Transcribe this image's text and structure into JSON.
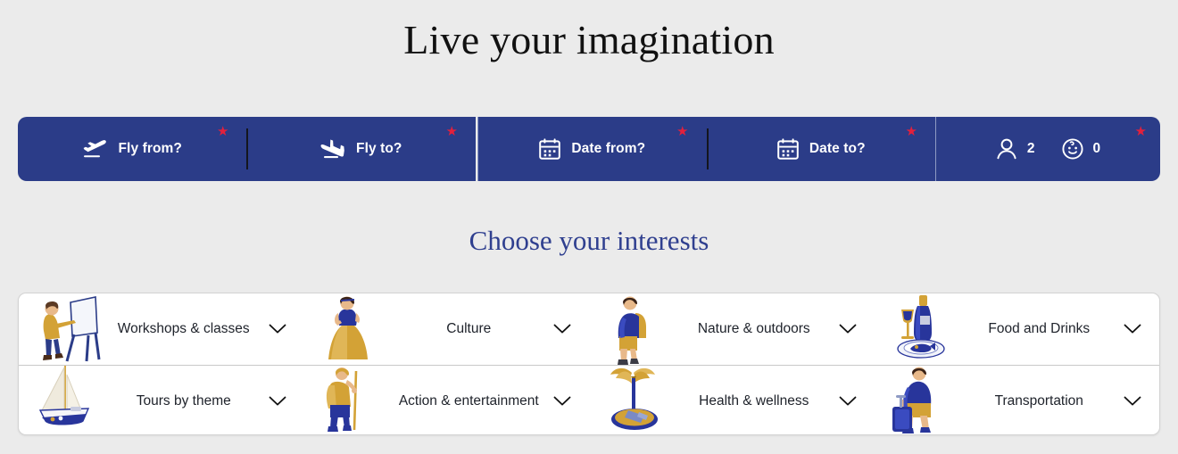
{
  "hero": {
    "title": "Live your imagination"
  },
  "searchbar": {
    "fields": [
      {
        "icon": "plane-takeoff-icon",
        "label": "Fly from?",
        "required": true
      },
      {
        "icon": "plane-landing-icon",
        "label": "Fly to?",
        "required": true
      },
      {
        "icon": "calendar-icon",
        "label": "Date from?",
        "required": true
      },
      {
        "icon": "calendar-icon",
        "label": "Date to?",
        "required": true
      }
    ],
    "passengers": {
      "required": true,
      "adults": {
        "icon": "person-icon",
        "count": "2"
      },
      "children": {
        "icon": "baby-face-icon",
        "count": "0"
      }
    }
  },
  "interests": {
    "heading": "Choose your interests",
    "rows": [
      [
        {
          "label": "Workshops & classes",
          "illustration": "easel-presenter-illustration",
          "chevron": "chevron-down-icon"
        },
        {
          "label": "Culture",
          "illustration": "woman-gown-illustration",
          "chevron": "chevron-down-icon"
        },
        {
          "label": "Nature & outdoors",
          "illustration": "hiker-backpack-illustration",
          "chevron": "chevron-down-icon"
        },
        {
          "label": "Food and Drinks",
          "illustration": "wine-dinner-illustration",
          "chevron": "chevron-down-icon"
        }
      ],
      [
        {
          "label": "Tours by theme",
          "illustration": "sailboat-illustration",
          "chevron": "chevron-down-icon"
        },
        {
          "label": "Action & entertainment",
          "illustration": "trekker-pole-illustration",
          "chevron": "chevron-down-icon"
        },
        {
          "label": "Health & wellness",
          "illustration": "palm-island-illustration",
          "chevron": "chevron-down-icon"
        },
        {
          "label": "Transportation",
          "illustration": "traveler-suitcase-illustration",
          "chevron": "chevron-down-icon"
        }
      ]
    ]
  },
  "colors": {
    "brand_navy": "#2b3c88",
    "heading_navy": "#2f3f8f",
    "required_red": "#e3203c",
    "page_bg": "#ebebeb",
    "card_bg": "#ffffff",
    "illu_gold": "#d3a236",
    "illu_blue": "#28359b"
  },
  "glyphs": {
    "required_marker": "★"
  }
}
